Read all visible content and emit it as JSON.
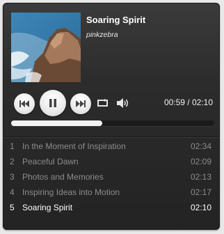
{
  "now_playing": {
    "title": "Soaring Spirit",
    "artist": "pinkzebra",
    "time": "00:59 / 02:10",
    "progress_fraction": 0.45
  },
  "controls": {
    "prev_icon": "previous-icon",
    "pause_icon": "pause-icon",
    "next_icon": "next-icon",
    "repeat_icon": "repeat-icon",
    "volume_icon": "volume-icon"
  },
  "playlist": [
    {
      "num": "1",
      "name": "In the Moment of Inspiration",
      "duration": "02:34"
    },
    {
      "num": "2",
      "name": "Peaceful Dawn",
      "duration": "02:09"
    },
    {
      "num": "3",
      "name": "Photos and Memories",
      "duration": "02:13"
    },
    {
      "num": "4",
      "name": "Inspiring Ideas into Motion",
      "duration": "02:17"
    },
    {
      "num": "5",
      "name": "Soaring Spirit",
      "duration": "02:10"
    }
  ],
  "active_index": 4,
  "colors": {
    "player_bg": "#2c2c2c",
    "text_active": "#ffffff",
    "text_muted": "#8c8c8c",
    "progress_fill": "#f2f2f2"
  }
}
